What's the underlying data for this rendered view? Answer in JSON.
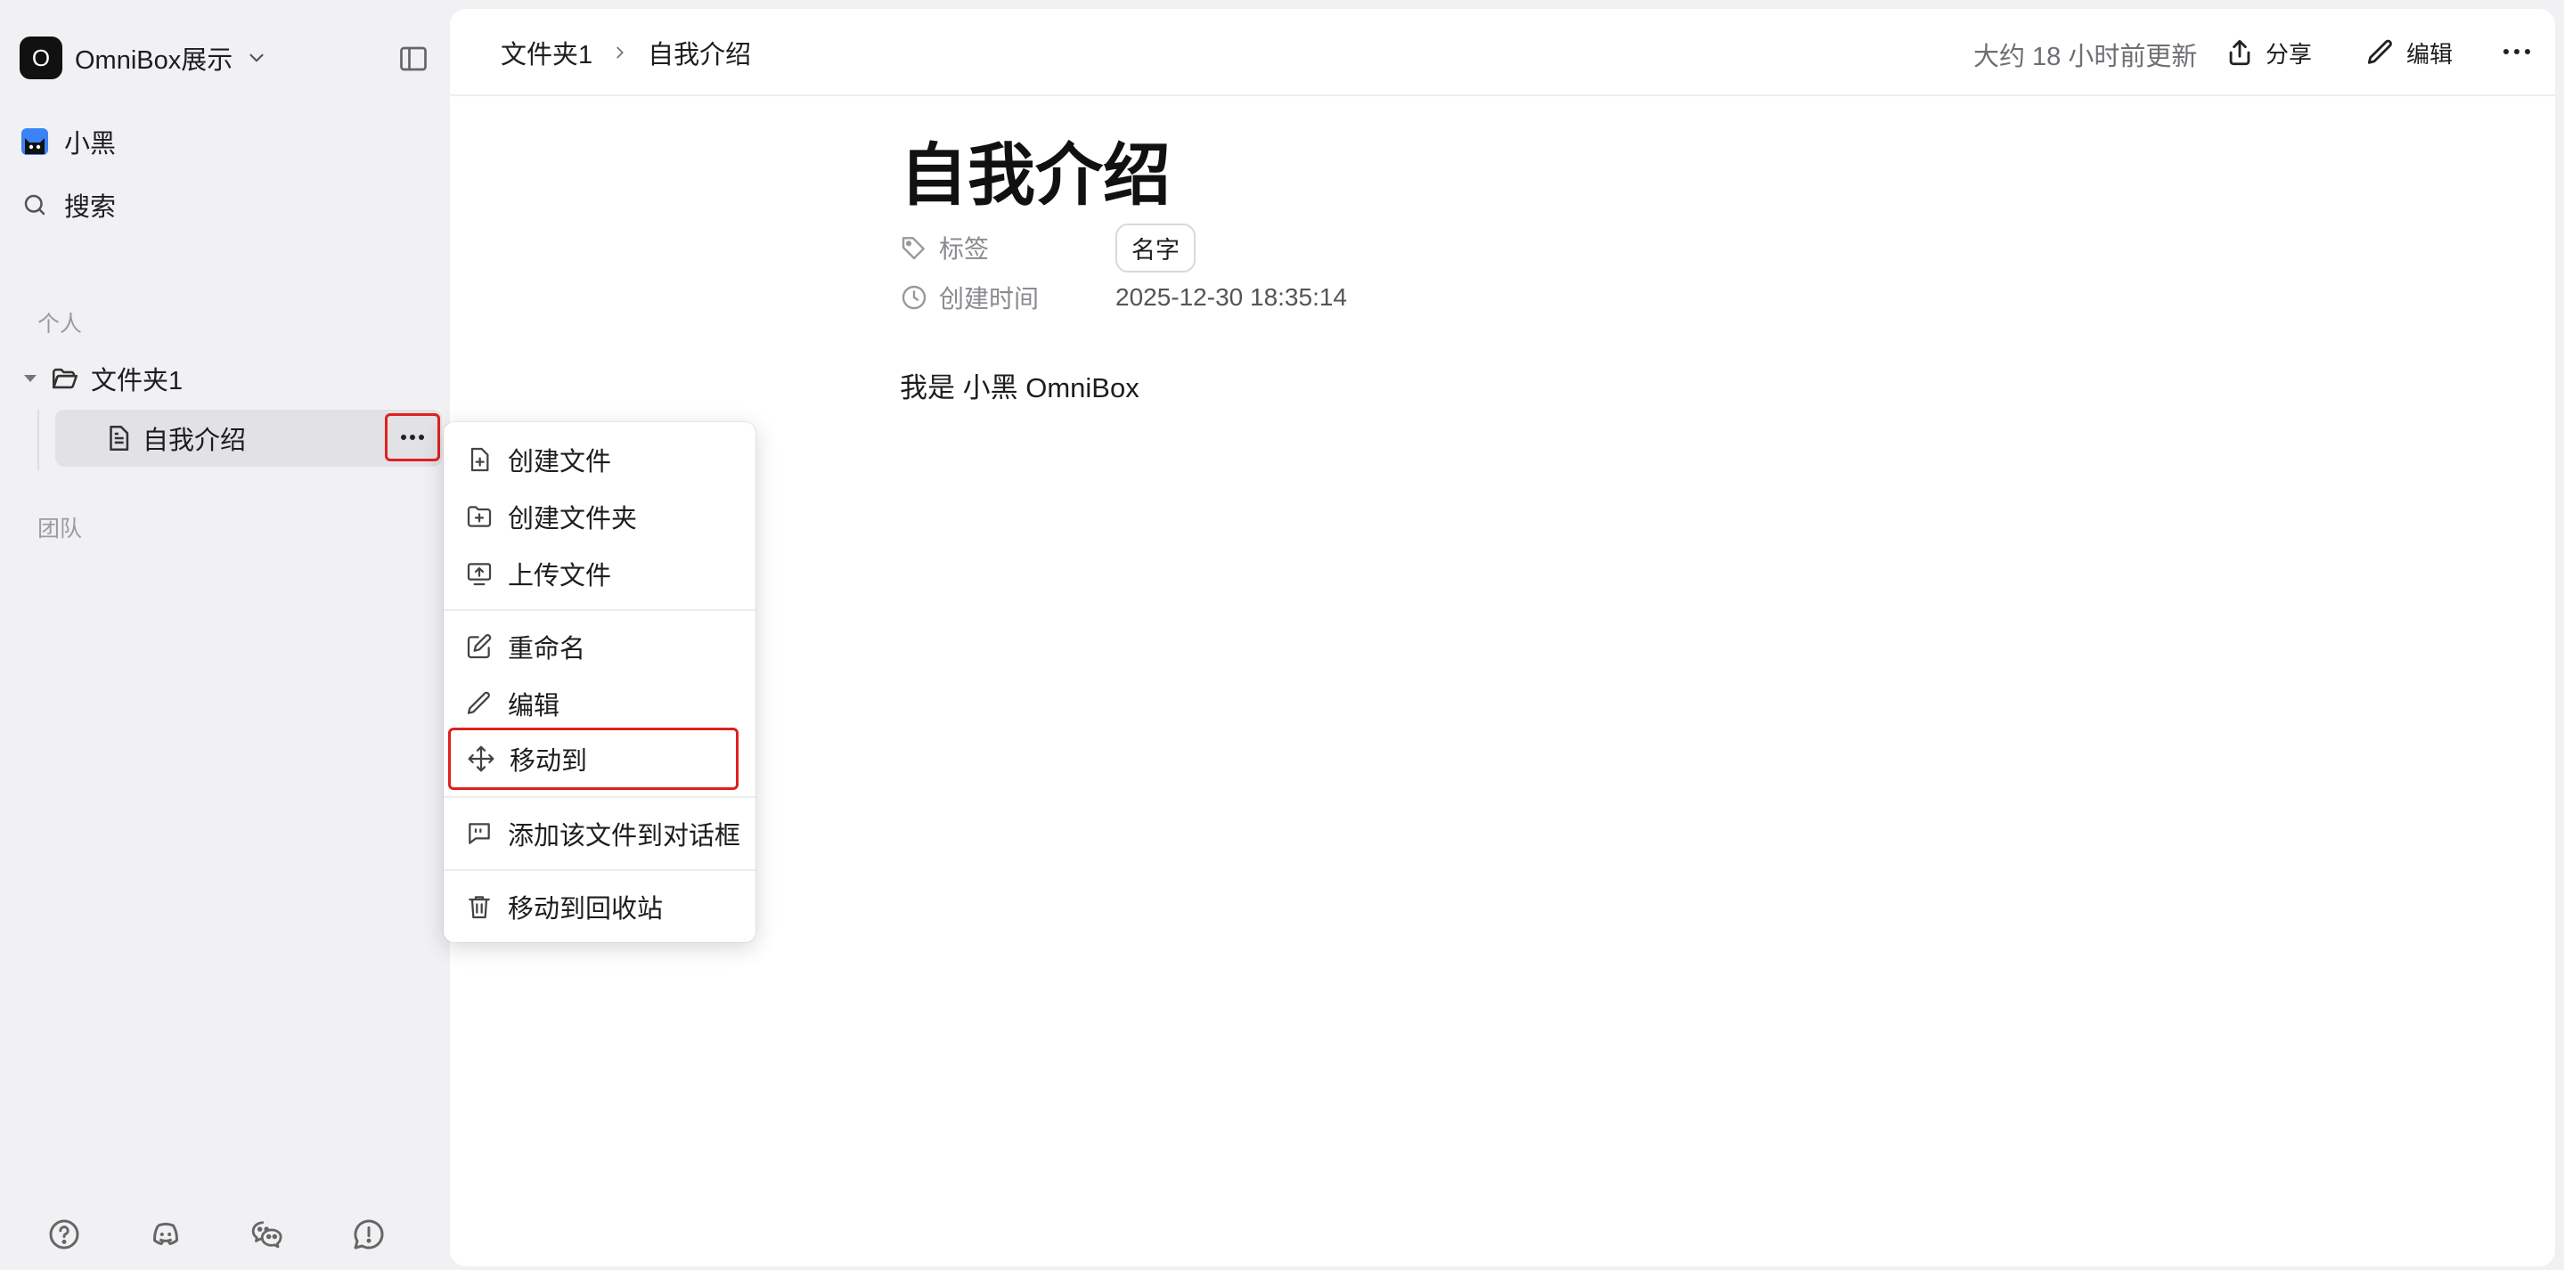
{
  "workspace": {
    "badge": "O",
    "name": "OmniBox展示"
  },
  "sidebar": {
    "user_label": "小黑",
    "search_label": "搜索",
    "section_personal": "个人",
    "folder_label": "文件夹1",
    "file_label": "自我介绍",
    "section_team": "团队"
  },
  "header": {
    "breadcrumb": [
      "文件夹1",
      "自我介绍"
    ],
    "updated": "大约 18 小时前更新",
    "share_label": "分享",
    "edit_label": "编辑"
  },
  "document": {
    "title": "自我介绍",
    "tags_key": "标签",
    "tag_value": "名字",
    "created_key": "创建时间",
    "created_value": "2025-12-30 18:35:14",
    "body": "我是 小黑 OmniBox"
  },
  "context_menu": {
    "create_file": "创建文件",
    "create_folder": "创建文件夹",
    "upload_file": "上传文件",
    "rename": "重命名",
    "edit": "编辑",
    "move_to": "移动到",
    "add_to_chat": "添加该文件到对话框",
    "move_to_trash": "移动到回收站"
  },
  "colors": {
    "highlight": "#e02020",
    "sidebar_bg": "#f1f1f4",
    "selected_row": "#e2e2e6"
  }
}
